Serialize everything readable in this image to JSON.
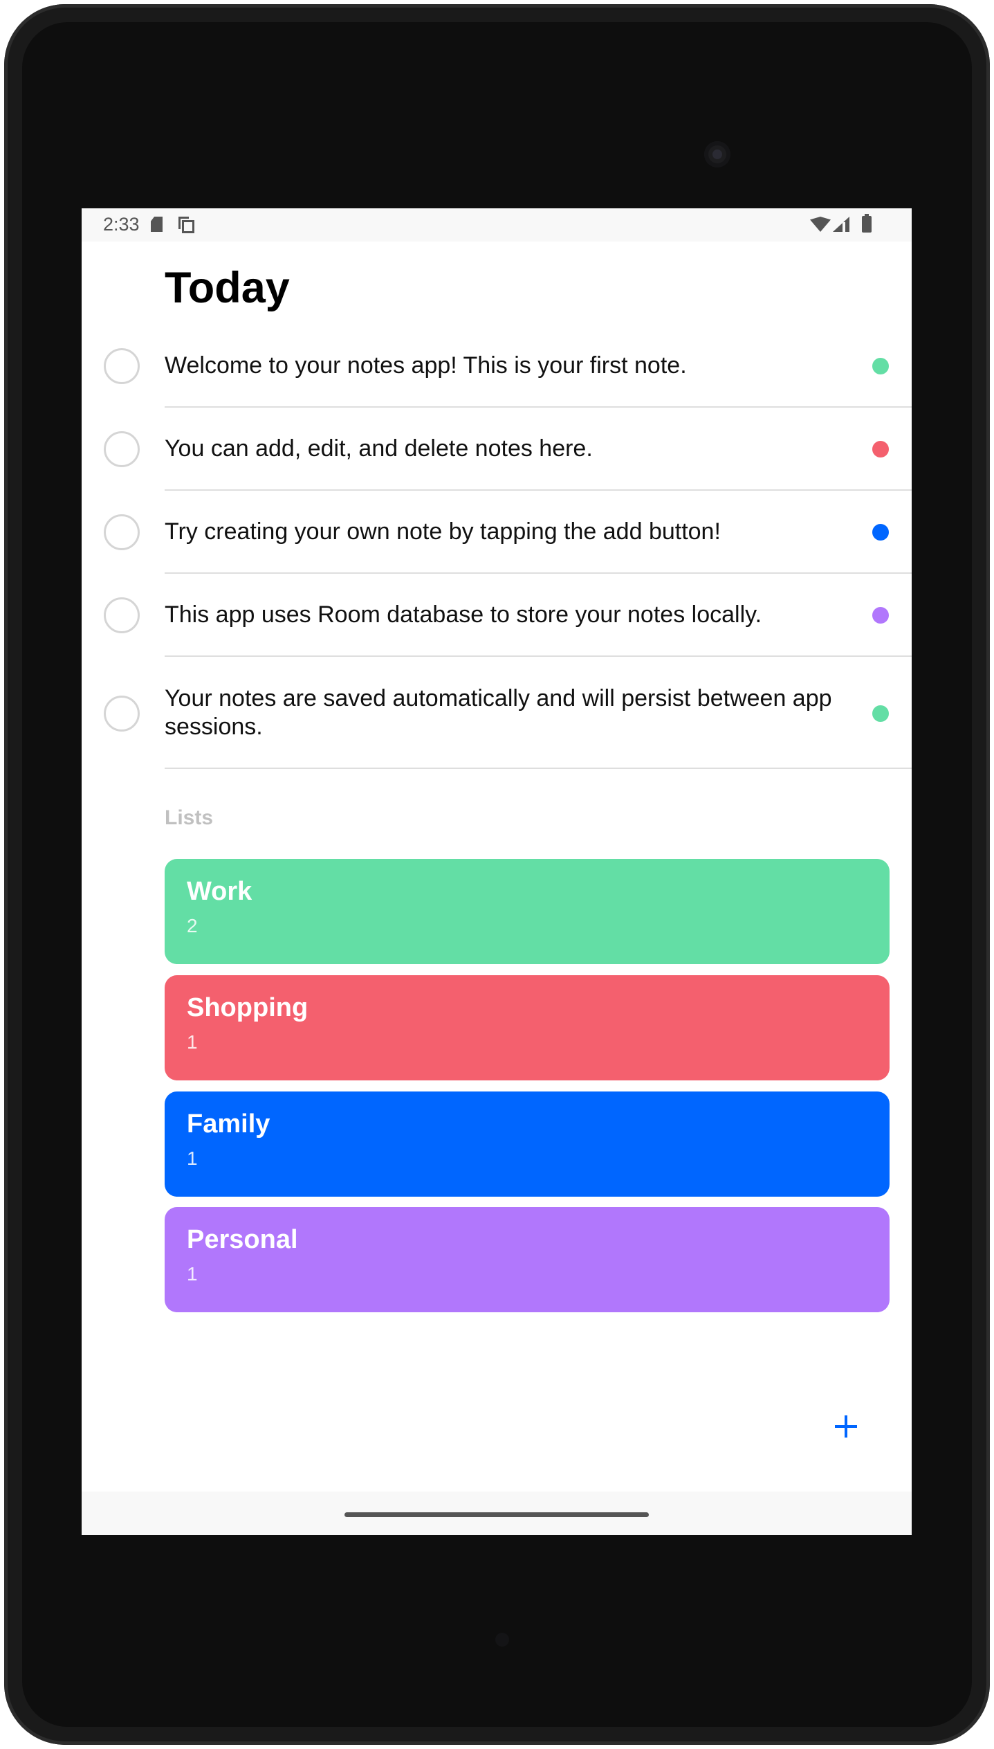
{
  "status_bar": {
    "time": "2:33",
    "icons": [
      "sd-card-icon",
      "copy-icon",
      "wifi-icon",
      "signal-icon",
      "battery-icon"
    ]
  },
  "page": {
    "title": "Today"
  },
  "notes": [
    {
      "text": "Welcome to your notes app! This is your first note.",
      "color": "#63dea5"
    },
    {
      "text": "You can add, edit, and delete notes here.",
      "color": "#f4606e"
    },
    {
      "text": "Try creating your own note by tapping the add button!",
      "color": "#0066ff"
    },
    {
      "text": "This app uses Room database to store your notes locally.",
      "color": "#b177fc"
    },
    {
      "text": "Your notes are saved automatically and will persist between app sessions.",
      "color": "#63dea5"
    }
  ],
  "lists": {
    "header": "Lists",
    "items": [
      {
        "name": "Work",
        "count": "2",
        "color": "#63dea5"
      },
      {
        "name": "Shopping",
        "count": "1",
        "color": "#f4606e"
      },
      {
        "name": "Family",
        "count": "1",
        "color": "#0066ff"
      },
      {
        "name": "Personal",
        "count": "1",
        "color": "#b177fc"
      }
    ]
  },
  "fab": {
    "icon": "plus-icon",
    "color": "#0066ff"
  }
}
